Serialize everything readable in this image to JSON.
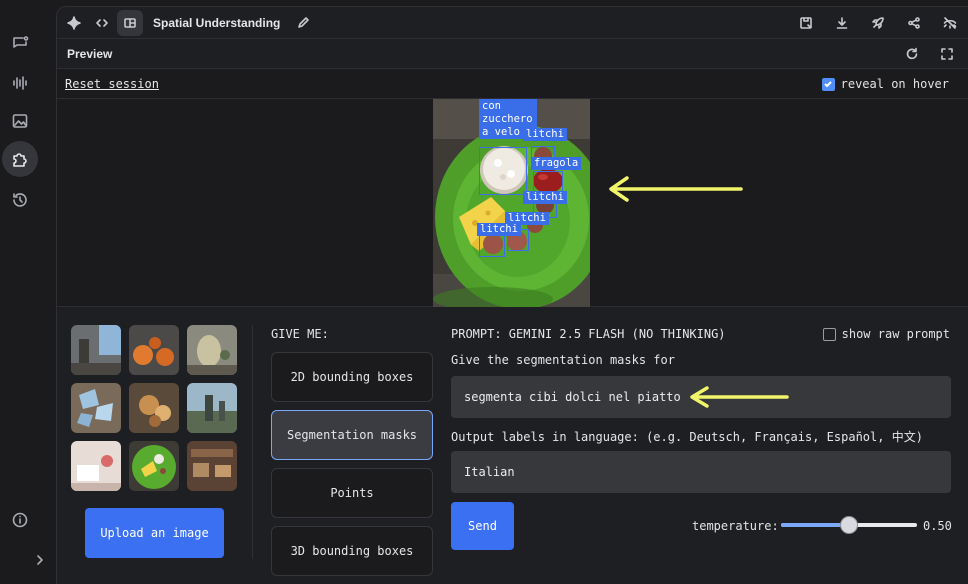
{
  "window": {
    "title": "Spatial Understanding"
  },
  "preview": {
    "label": "Preview"
  },
  "session": {
    "reset_label": "Reset session",
    "reveal_label": "reveal on hover",
    "reveal_checked": true
  },
  "detections": [
    {
      "label": "muffin\ncon\nzucchero\na velo"
    },
    {
      "label": "litchi"
    },
    {
      "label": "fragola"
    },
    {
      "label": "litchi"
    },
    {
      "label": "litchi"
    },
    {
      "label": "litchi"
    }
  ],
  "controls": {
    "give_me_label": "GIVE ME:",
    "modes": [
      {
        "label": "2D bounding boxes"
      },
      {
        "label": "Segmentation masks"
      },
      {
        "label": "Points"
      },
      {
        "label": "3D bounding boxes"
      }
    ],
    "selected_mode": "Segmentation masks",
    "upload_label": "Upload an image",
    "prompt_header": "PROMPT: GEMINI 2.5 FLASH (NO THINKING)",
    "show_raw_label": "show raw prompt",
    "show_raw_checked": false,
    "segmentation_label": "Give the segmentation masks for",
    "segmentation_value": "segmenta cibi dolci nel piatto",
    "language_label": "Output labels in language: (e.g. Deutsch, Français, Español, 中文)",
    "language_value": "Italian",
    "send_label": "Send",
    "temperature_label": "temperature:",
    "temperature_value": "0.50",
    "temperature_fraction": 0.5
  },
  "colors": {
    "accent": "#3c70f2",
    "annotation_arrow": "#f2f56a",
    "bbox": "#3a6ee8"
  }
}
